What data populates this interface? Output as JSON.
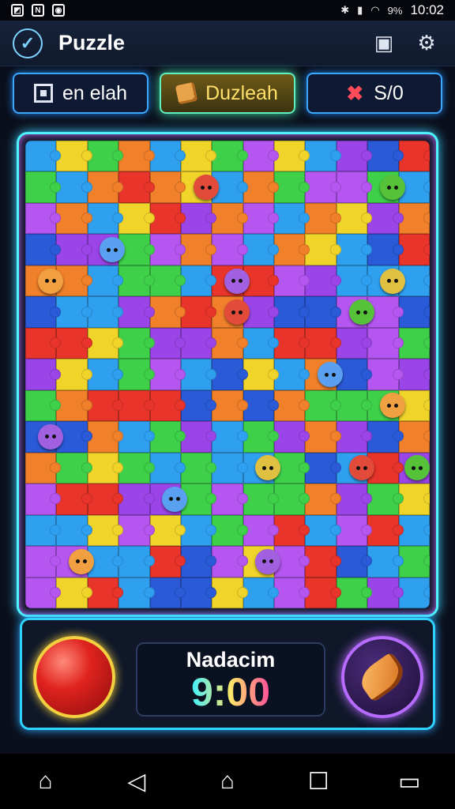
{
  "status_bar": {
    "time": "10:02",
    "battery": "9%",
    "left_icons": [
      "maps-icon",
      "nfc-icon",
      "app-icon"
    ],
    "sys_text": "ıl ıl"
  },
  "app_bar": {
    "title": "Puzzle"
  },
  "tabs": [
    {
      "label": "en elah",
      "icon": "square-icon",
      "active": false
    },
    {
      "label": "Duzleah",
      "icon": "puzzle-piece-icon",
      "active": true
    },
    {
      "label": "S/0",
      "icon": "cross-icon",
      "active": false
    }
  ],
  "board": {
    "cols": 13,
    "rows": 15,
    "palette": [
      "#3fd04a",
      "#f0802a",
      "#9b45e8",
      "#2fa0f0",
      "#f0d42a",
      "#e8342a",
      "#2a5ad8",
      "#b556f0"
    ]
  },
  "timer": {
    "label": "Nadacim",
    "value": "9:00"
  },
  "colors": {
    "accent_cyan": "#4ff3ff",
    "accent_purple": "#b86cff",
    "accent_yellow": "#f3d03f"
  }
}
